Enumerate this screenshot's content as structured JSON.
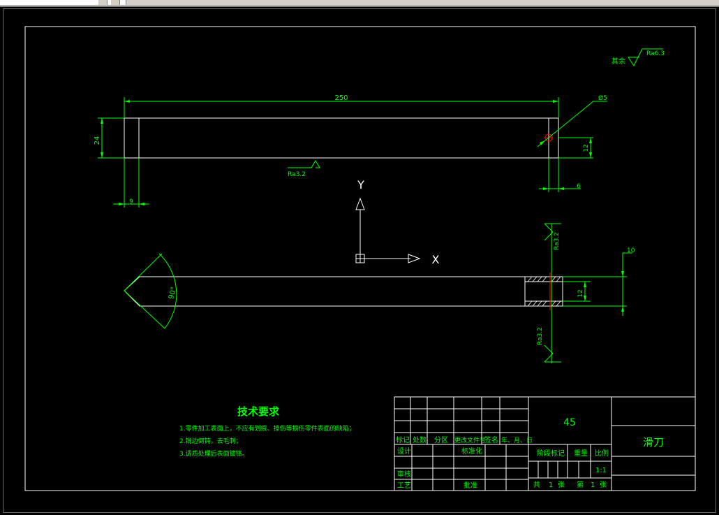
{
  "drawing": {
    "dims": {
      "length": "250",
      "height": "24",
      "offset_left": "9",
      "hole_from_bottom": "12",
      "hole_from_right": "6",
      "hole_dia": "Ø5",
      "angle": "90°",
      "thickness": "10",
      "slot": "12"
    },
    "roughness": {
      "surface_top": "Ra3.2",
      "other": "其余",
      "other_value": "Ra6.3",
      "hole_upper": "Ra3.2",
      "hole_lower": "Ra3.2"
    },
    "ucs": {
      "y": "Y",
      "x": "X"
    }
  },
  "tech": {
    "title": "技术要求",
    "items": [
      "1.零件加工表面上，不应有划痕、擦伤等损伤零件表面的缺陷；",
      "2.锐边倒钝，去毛刺；",
      "3.调质处理后表面镀铬。"
    ]
  },
  "title_block": {
    "material": "45",
    "part_name": "滑刀",
    "scale": "1:1",
    "labels": {
      "mark": "标记",
      "count": "处数",
      "zone": "分区",
      "change_doc": "更改文件号",
      "sign": "签名",
      "date": "年、月、日",
      "design": "设计",
      "standard": "标准化",
      "stage_mark": "阶段标记",
      "weight": "重量",
      "ratio": "比例",
      "review": "审核",
      "process": "工艺",
      "approve": "批准",
      "total": "共",
      "sheet_unit": "张",
      "sheet_no": "第",
      "sheet_no2": "张",
      "num_total": "1",
      "num_sheet": "1"
    }
  },
  "colors": {
    "background": "#000000",
    "annotation": "#00ff00",
    "geometry": "#ffffff",
    "center": "#ff0000"
  }
}
